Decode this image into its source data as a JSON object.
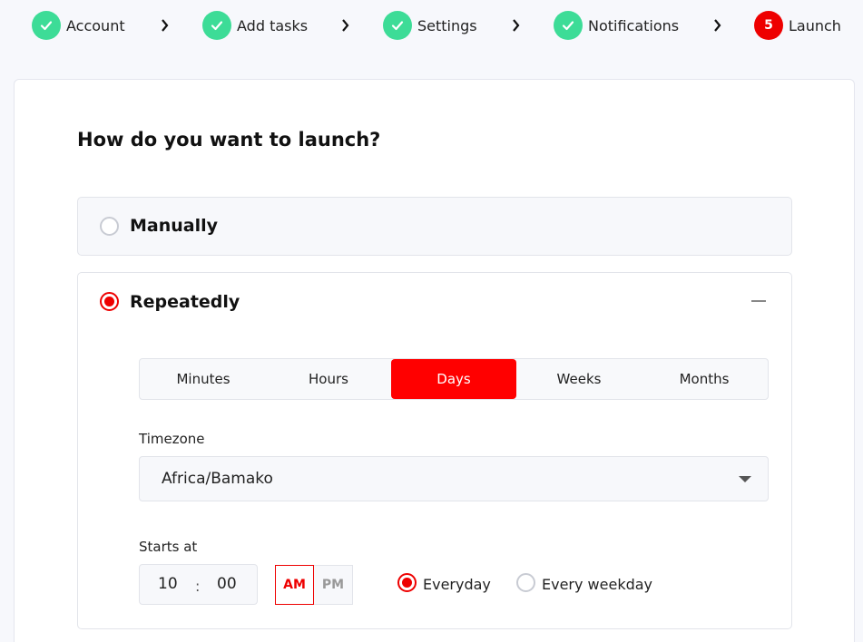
{
  "stepper": {
    "steps": [
      {
        "label": "Account",
        "status": "done"
      },
      {
        "label": "Add tasks",
        "status": "done"
      },
      {
        "label": "Settings",
        "status": "done"
      },
      {
        "label": "Notifications",
        "status": "done"
      },
      {
        "label": "Launch",
        "status": "active",
        "number": "5"
      }
    ]
  },
  "question": "How do you want to launch?",
  "options": {
    "manual": {
      "label": "Manually",
      "selected": false
    },
    "repeat": {
      "label": "Repeatedly",
      "selected": true
    }
  },
  "intervals": {
    "items": [
      "Minutes",
      "Hours",
      "Days",
      "Weeks",
      "Months"
    ],
    "selected": "Days"
  },
  "timezone": {
    "label": "Timezone",
    "value": "Africa/Bamako"
  },
  "starts_at": {
    "label": "Starts at",
    "hour": "10",
    "separator": ":",
    "minute": "00",
    "am_label": "AM",
    "pm_label": "PM",
    "period": "AM"
  },
  "frequency": {
    "everyday_label": "Everyday",
    "weekday_label": "Every weekday",
    "selected": "Everyday"
  },
  "colors": {
    "accent": "#ee0000",
    "done": "#3ddc97"
  }
}
